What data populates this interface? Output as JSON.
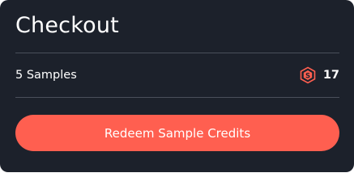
{
  "checkout": {
    "title": "Checkout",
    "item_label": "5 Samples",
    "credit_amount": "17",
    "credit_icon": "sample-credit-coin-icon",
    "redeem_button_label": "Redeem Sample Credits"
  },
  "colors": {
    "card_background": "#1c212b",
    "divider": "#4a505b",
    "accent": "#ff5f50",
    "text": "#ffffff"
  }
}
